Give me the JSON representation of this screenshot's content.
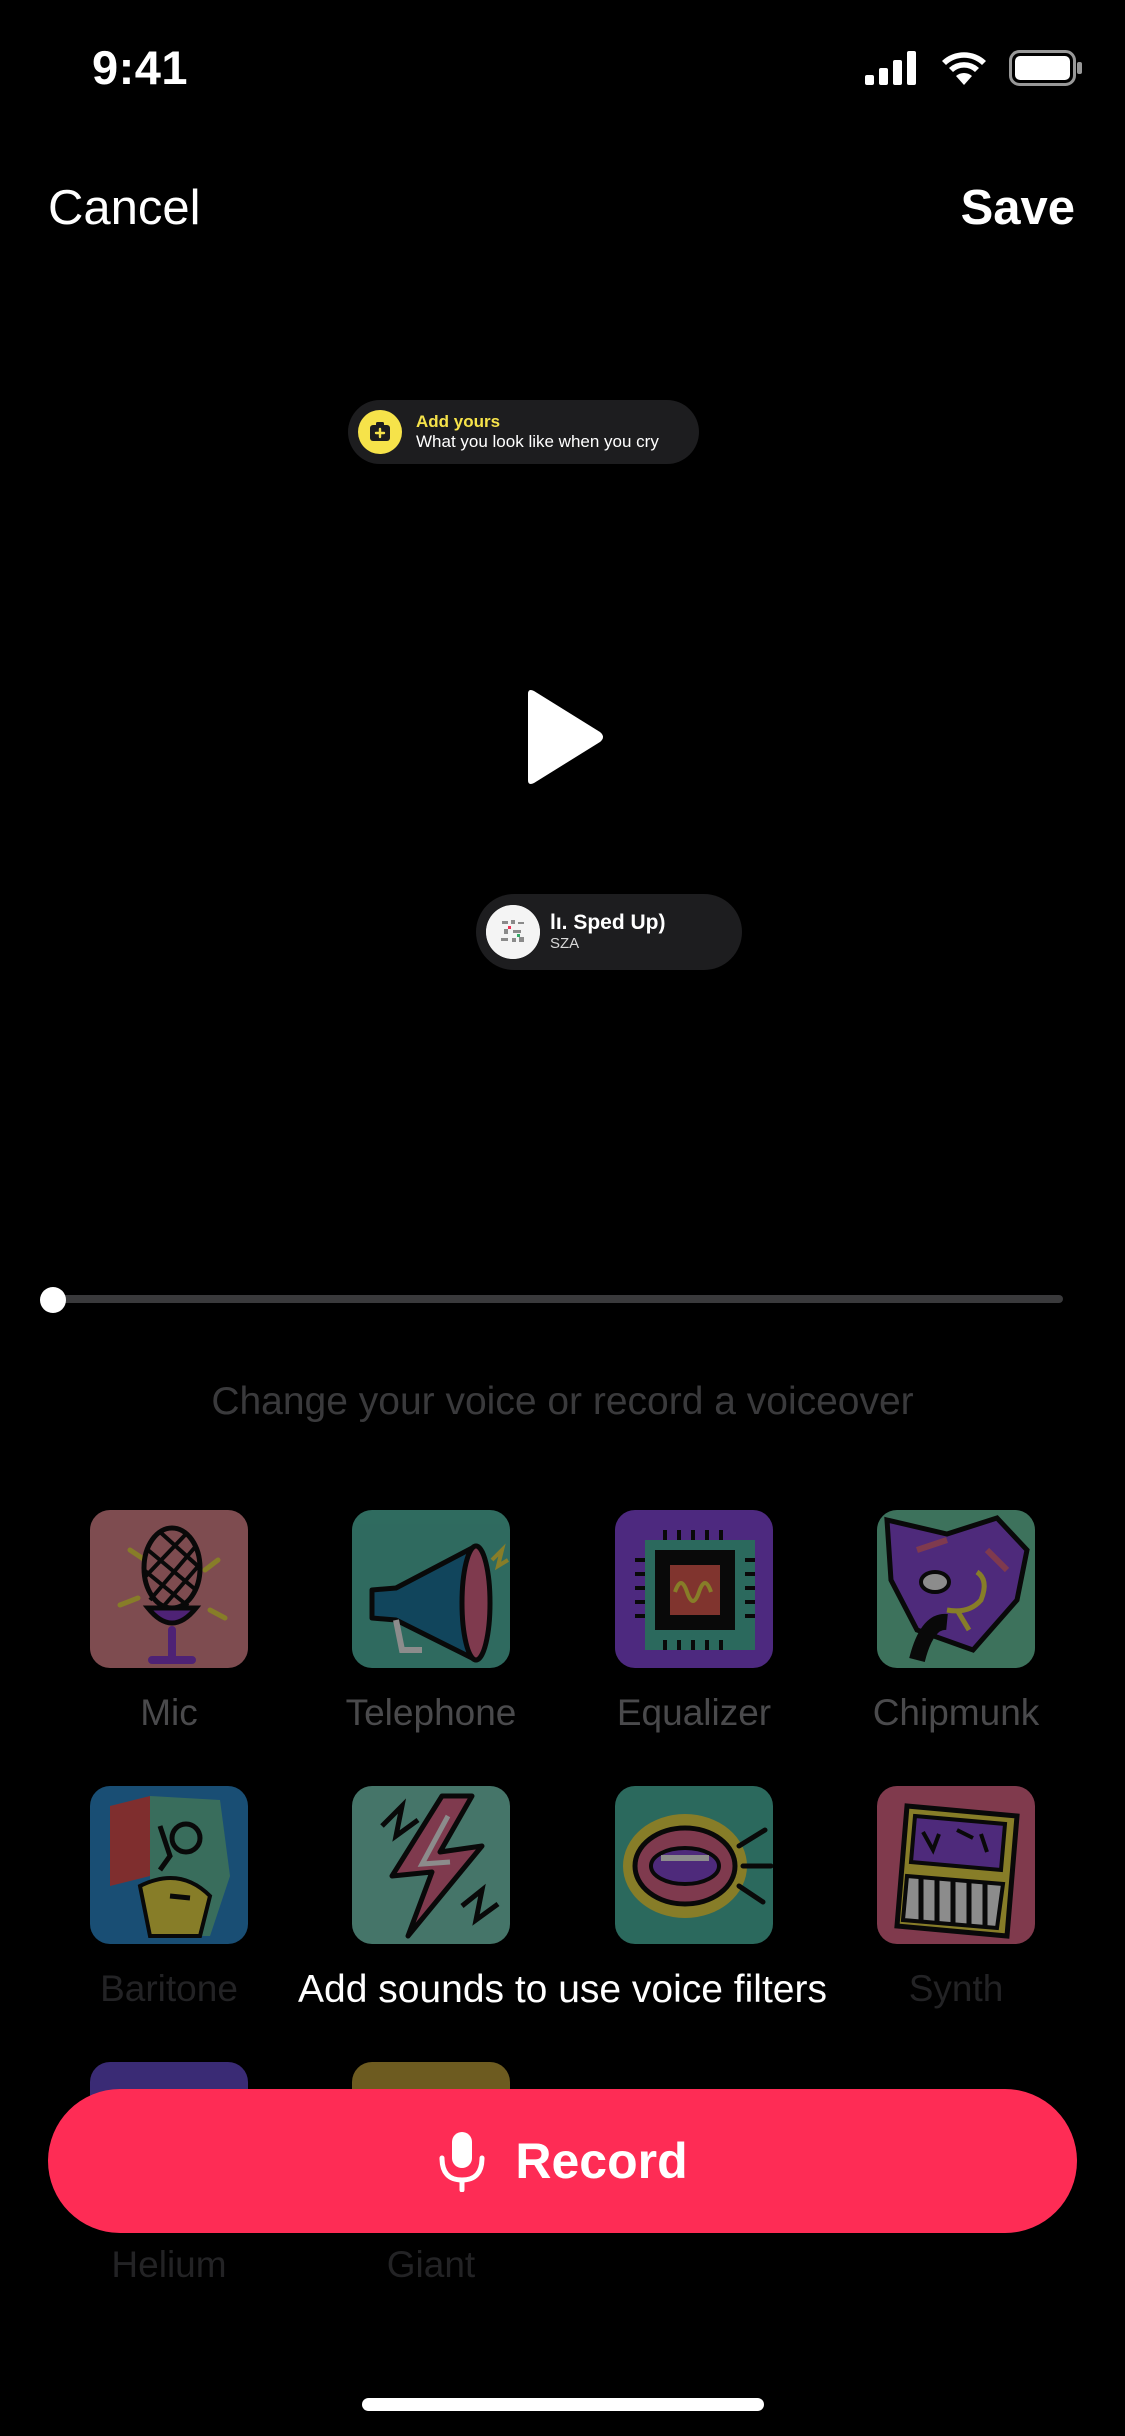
{
  "status_bar": {
    "time": "9:41"
  },
  "nav": {
    "cancel": "Cancel",
    "save": "Save"
  },
  "add_yours_sticker": {
    "title": "Add yours",
    "prompt": "What you look like when you cry"
  },
  "music_sticker": {
    "title": "lı. Sped Up)",
    "artist": "SZA"
  },
  "playback": {
    "progress": 0
  },
  "hint": "Change your voice or record a voiceover",
  "filters": [
    {
      "label": "Mic",
      "icon": "mic-icon"
    },
    {
      "label": "Telephone",
      "icon": "megaphone-icon"
    },
    {
      "label": "Equalizer",
      "icon": "chip-icon"
    },
    {
      "label": "Chipmunk",
      "icon": "cat-icon"
    },
    {
      "label": "Baritone",
      "icon": "face-icon"
    },
    {
      "label": "",
      "icon": "lightning-icon"
    },
    {
      "label": "",
      "icon": "mouth-icon"
    },
    {
      "label": "Synth",
      "icon": "synth-icon"
    },
    {
      "label": "Helium",
      "icon": "helium-icon"
    },
    {
      "label": "Giant",
      "icon": "giant-icon"
    }
  ],
  "overlay_message": "Add sounds to use voice filters",
  "record_button": {
    "label": "Record"
  },
  "colors": {
    "accent": "#fe2c55",
    "sticker_yellow": "#f6e34a",
    "background": "#000000"
  }
}
